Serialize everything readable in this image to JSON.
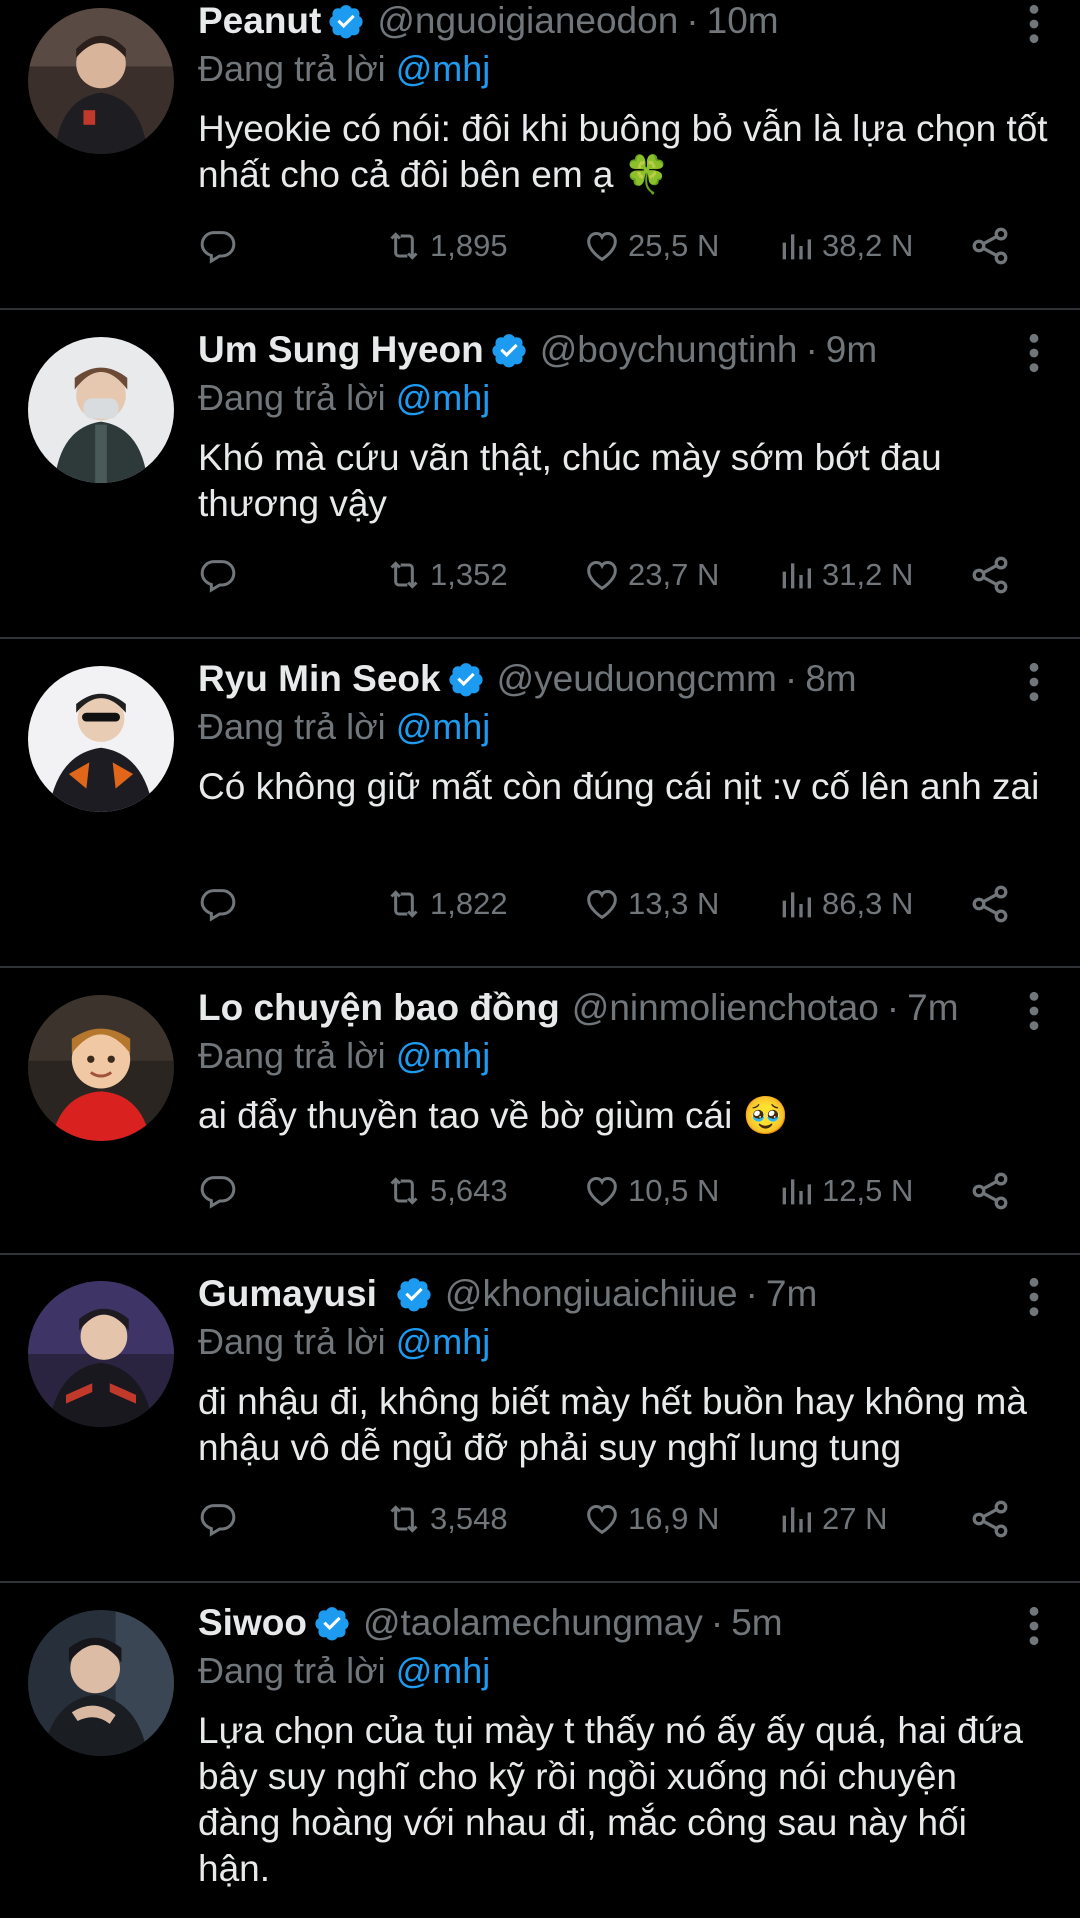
{
  "reply_prefix": "Đang trả lời",
  "tweets": [
    {
      "name": "Peanut",
      "handle": "@nguoigianeodon",
      "time": "10m",
      "reply_to": "@mhj",
      "text": "Hyeokie có nói: đôi khi buông bỏ vẫn là lựa chọn tốt nhất cho cả đôi bên em ạ 🍀",
      "retweets": "1,895",
      "likes": "25,5 N",
      "views": "38,2 N"
    },
    {
      "name": "Um Sung Hyeon",
      "handle": "@boychungtinh",
      "time": "9m",
      "reply_to": "@mhj",
      "text": "Khó mà cứu vãn thật, chúc mày sớm bớt đau thương vậy",
      "retweets": "1,352",
      "likes": "23,7 N",
      "views": "31,2 N"
    },
    {
      "name": "Ryu Min Seok",
      "handle": "@yeuduongcmm",
      "time": "8m",
      "reply_to": "@mhj",
      "text": "Có không giữ mất còn đúng cái nịt :v cố lên anh zai",
      "retweets": "1,822",
      "likes": "13,3 N",
      "views": "86,3 N"
    },
    {
      "name": "Lo chuyện bao đồng",
      "handle": "@ninmolienchotao",
      "time": "7m",
      "reply_to": "@mhj",
      "text": "ai đẩy thuyền tao về bờ giùm cái 🥹",
      "retweets": "5,643",
      "likes": "10,5 N",
      "views": "12,5 N"
    },
    {
      "name": "Gumayusi",
      "handle": "@khongiuaichiiue",
      "time": "7m",
      "reply_to": "@mhj",
      "text": "đi nhậu đi, không biết mày hết buồn hay không mà nhậu vô dễ ngủ đỡ phải suy nghĩ lung tung",
      "retweets": "3,548",
      "likes": "16,9 N",
      "views": "27 N"
    },
    {
      "name": "Siwoo",
      "handle": "@taolamechungmay",
      "time": "5m",
      "reply_to": "@mhj",
      "text": "Lựa chọn của tụi mày t thấy nó ấy ấy quá, hai đứa bây suy nghĩ cho kỹ rồi ngồi xuống nói chuyện đàng hoàng với nhau đi, mắc công sau này hối hận."
    }
  ],
  "colors": {
    "background": "#000000",
    "primary_text": "#e7e9ea",
    "secondary_text": "#71767b",
    "accent": "#1d9bf0",
    "divider": "#2f3336"
  },
  "icons": [
    "verified-badge-icon",
    "more-options-icon",
    "reply-icon",
    "retweet-icon",
    "like-icon",
    "views-icon",
    "share-icon"
  ]
}
